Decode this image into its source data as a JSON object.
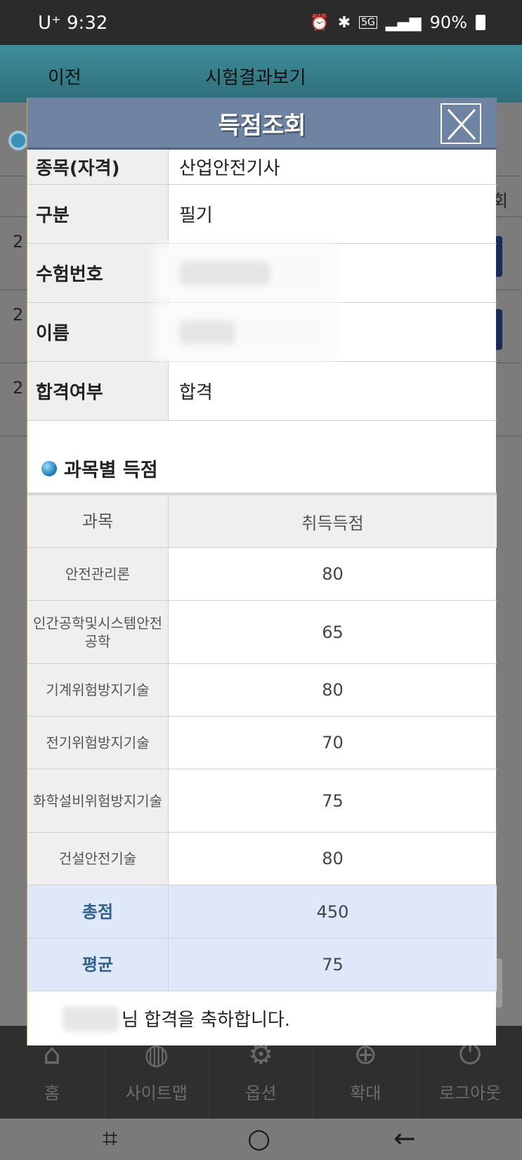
{
  "status_bar": {
    "carrier_time": "U⁺ 9:32",
    "network": "5G",
    "battery": "90%"
  },
  "background_page": {
    "back_label": "이전",
    "page_title": "시험결과보기",
    "row_numbers": [
      "2",
      "2",
      "2"
    ],
    "column_fragment": "회"
  },
  "modal": {
    "title": "득점조회",
    "info": [
      {
        "label": "종목(자격)",
        "value": "산업안전기사"
      },
      {
        "label": "구분",
        "value": "필기"
      },
      {
        "label": "수험번호",
        "value": ""
      },
      {
        "label": "이름",
        "value": ""
      },
      {
        "label": "합격여부",
        "value": "합격"
      }
    ],
    "section_title": "과목별 득점",
    "score_header": {
      "subject": "과목",
      "score": "취득득점"
    },
    "scores": [
      {
        "subject": "안전관리론",
        "score": "80"
      },
      {
        "subject": "인간공학및시스템안전공학",
        "score": "65"
      },
      {
        "subject": "기계위험방지기술",
        "score": "80"
      },
      {
        "subject": "전기위험방지기술",
        "score": "70"
      },
      {
        "subject": "화학설비위험방지기술",
        "score": "75"
      },
      {
        "subject": "건설안전기술",
        "score": "80"
      }
    ],
    "total": {
      "label": "총점",
      "value": "450"
    },
    "average": {
      "label": "평균",
      "value": "75"
    },
    "congrats_suffix": "님 합격을 축하합니다."
  },
  "bottom_nav": [
    {
      "label": "홈",
      "icon": "home-icon"
    },
    {
      "label": "사이트맵",
      "icon": "globe-icon"
    },
    {
      "label": "옵션",
      "icon": "gear-icon"
    },
    {
      "label": "확대",
      "icon": "plus-icon"
    },
    {
      "label": "로그아웃",
      "icon": "power-icon"
    }
  ]
}
